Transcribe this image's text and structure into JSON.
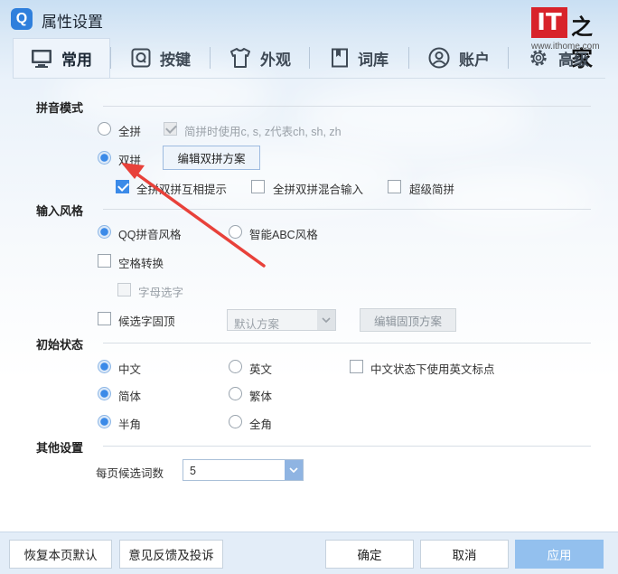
{
  "window": {
    "title": "属性设置",
    "app_icon_text": "Q",
    "watermark": {
      "brand_it": "IT",
      "brand_zh": "之家",
      "url": "www.ithome.com"
    }
  },
  "tabs": [
    {
      "label": "常用",
      "icon": "monitor-icon",
      "active": true
    },
    {
      "label": "按键",
      "icon": "key-q-icon",
      "active": false
    },
    {
      "label": "外观",
      "icon": "tshirt-icon",
      "active": false
    },
    {
      "label": "词库",
      "icon": "book-icon",
      "active": false
    },
    {
      "label": "账户",
      "icon": "user-icon",
      "active": false
    },
    {
      "label": "高级",
      "icon": "gear-icon",
      "active": false
    }
  ],
  "pinyin_mode": {
    "title": "拼音模式",
    "full_pinyin": "全拼",
    "jianpin_hint": "简拼时使用c, s, z代表ch, sh, zh",
    "shuangpin": "双拼",
    "edit_shuangpin_button": "编辑双拼方案",
    "mutual_hint": "全拼双拼互相提示",
    "mixed_input": "全拼双拼混合输入",
    "super_jianpin": "超级简拼"
  },
  "input_style": {
    "title": "输入风格",
    "qq_style": "QQ拼音风格",
    "abc_style": "智能ABC风格",
    "space_convert": "空格转换",
    "letter_select": "字母选字",
    "candidate_top": "候选字固顶",
    "scheme_select_value": "默认方案",
    "edit_top_button": "编辑固顶方案"
  },
  "initial_state": {
    "title": "初始状态",
    "chinese": "中文",
    "english": "英文",
    "english_punct": "中文状态下使用英文标点",
    "simplified": "简体",
    "traditional": "繁体",
    "half_width": "半角",
    "full_width": "全角"
  },
  "other": {
    "title": "其他设置",
    "per_page_label": "每页候选词数",
    "per_page_value": "5"
  },
  "footer": {
    "restore": "恢复本页默认",
    "feedback": "意见反馈及投诉",
    "ok": "确定",
    "cancel": "取消",
    "apply": "应用"
  },
  "colors": {
    "accent": "#3b8ae8",
    "annotation_arrow": "#e8413a",
    "apply_button": "#93c0ee"
  }
}
